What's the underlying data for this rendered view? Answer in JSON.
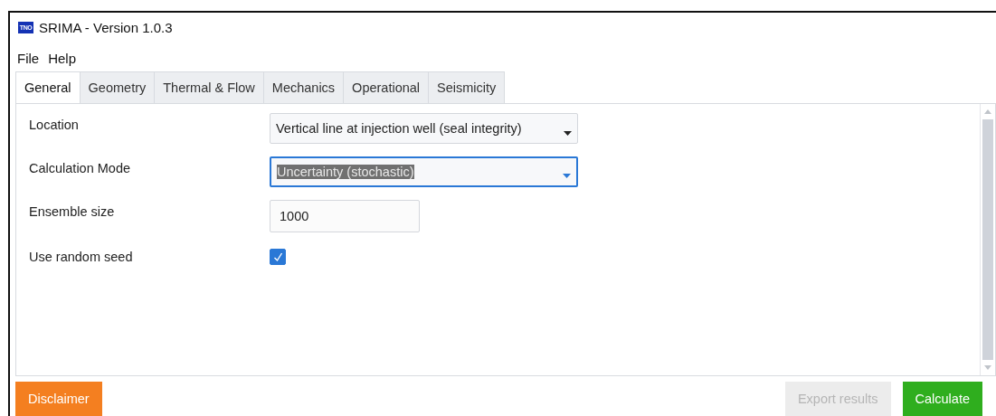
{
  "window": {
    "title": "SRIMA - Version 1.0.3",
    "logo": "TNO"
  },
  "menu": [
    "File",
    "Help"
  ],
  "tabs": [
    {
      "label": "General",
      "selected": true
    },
    {
      "label": "Geometry",
      "selected": false
    },
    {
      "label": "Thermal & Flow",
      "selected": false
    },
    {
      "label": "Mechanics",
      "selected": false
    },
    {
      "label": "Operational",
      "selected": false
    },
    {
      "label": "Seismicity",
      "selected": false
    }
  ],
  "fields": [
    {
      "kind": "dropdown",
      "label": "Location",
      "value": "Vertical line at injection well (seal integrity)",
      "focused": false
    },
    {
      "kind": "dropdown",
      "label": "Calculation Mode",
      "value": "Uncertainty (stochastic)",
      "focused": true
    },
    {
      "kind": "text",
      "label": "Ensemble size",
      "value": "1000"
    },
    {
      "kind": "checkbox",
      "label": "Use random seed",
      "checked": true
    }
  ],
  "buttons": [
    {
      "kind": "warning",
      "label": "Disclaimer",
      "disabled": false
    },
    {
      "kind": "plain",
      "label": "Export results",
      "disabled": true
    },
    {
      "kind": "primary",
      "label": "Calculate",
      "disabled": false
    }
  ]
}
